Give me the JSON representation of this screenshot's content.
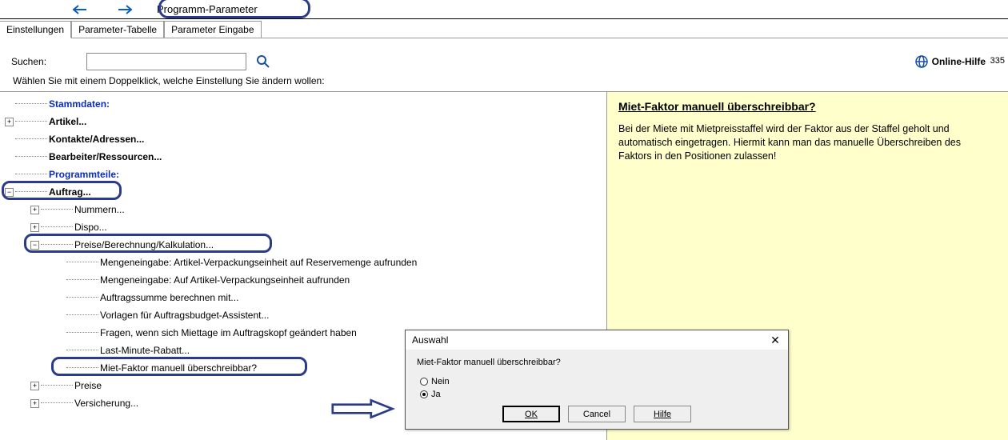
{
  "toolbar": {
    "title": "Programm-Parameter"
  },
  "tabs": [
    "Einstellungen",
    "Parameter-Tabelle",
    "Parameter Eingabe"
  ],
  "search": {
    "label": "Suchen:",
    "placeholder": ""
  },
  "hint": "Wählen Sie mit einem Doppelklick, welche Einstellung Sie ändern wollen:",
  "help": {
    "label": "Online-Hilfe"
  },
  "page_num": "335",
  "tree": {
    "cat1": "Stammdaten:",
    "n_artikel": "Artikel...",
    "n_kontakte": "Kontakte/Adressen...",
    "n_bearbeiter": "Bearbeiter/Ressourcen...",
    "cat2": "Programmteile:",
    "n_auftrag": "Auftrag...",
    "n_nummern": "Nummern...",
    "n_dispo": "Dispo...",
    "n_preiseberech": "Preise/Berechnung/Kalkulation...",
    "n_mengen1": "Mengeneingabe: Artikel-Verpackungseinheit auf Reservemenge aufrunden",
    "n_mengen2": "Mengeneingabe: Auf Artikel-Verpackungseinheit aufrunden",
    "n_auftragssumme": "Auftragssumme berechnen mit...",
    "n_vorlagen": "Vorlagen für Auftragsbudget-Assistent...",
    "n_fragen": "Fragen, wenn sich Miettage im Auftragskopf geändert haben",
    "n_lastmin": "Last-Minute-Rabatt...",
    "n_mietfaktor": "Miet-Faktor manuell überschreibbar?",
    "n_preise": "Preise",
    "n_versicherung": "Versicherung..."
  },
  "info": {
    "title": "Miet-Faktor manuell überschreibbar?",
    "body": "Bei der Miete mit Mietpreisstaffel wird der Faktor aus der Staffel geholt und automatisch eingetragen. Hiermit kann man das manuelle Überschreiben des Faktors in den Positionen zulassen!"
  },
  "dialog": {
    "title": "Auswahl",
    "question": "Miet-Faktor manuell überschreibbar?",
    "opt_nein": "Nein",
    "opt_ja": "Ja",
    "ok": "OK",
    "cancel": "Cancel",
    "help": "Hilfe"
  }
}
